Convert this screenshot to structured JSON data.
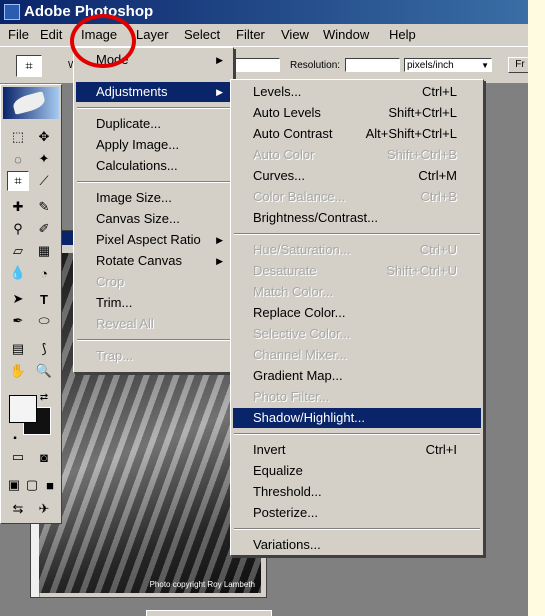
{
  "window": {
    "title": "Adobe Photoshop",
    "app_icon": "photoshop-icon"
  },
  "menubar": {
    "items": [
      "File",
      "Edit",
      "Image",
      "Layer",
      "Select",
      "Filter",
      "View",
      "Window",
      "Help"
    ]
  },
  "options_bar": {
    "width_label": "W",
    "resolution_label": "Resolution:",
    "resolution_value": "",
    "units": "pixels/inch",
    "front_button": "Fr"
  },
  "image_menu": {
    "items": [
      {
        "label": "Mode",
        "submenu": true,
        "disabled": false
      },
      {
        "label": "Adjustments",
        "submenu": true,
        "disabled": false,
        "highlighted": true
      },
      {
        "label": "Duplicate...",
        "disabled": false
      },
      {
        "label": "Apply Image...",
        "disabled": false
      },
      {
        "label": "Calculations...",
        "disabled": false
      },
      {
        "label": "Image Size...",
        "disabled": false
      },
      {
        "label": "Canvas Size...",
        "disabled": false
      },
      {
        "label": "Pixel Aspect Ratio",
        "submenu": true,
        "disabled": false
      },
      {
        "label": "Rotate Canvas",
        "submenu": true,
        "disabled": false
      },
      {
        "label": "Crop",
        "disabled": true
      },
      {
        "label": "Trim...",
        "disabled": false
      },
      {
        "label": "Reveal All",
        "disabled": true
      },
      {
        "label": "Trap...",
        "disabled": true
      }
    ]
  },
  "adjustments_menu": {
    "items": [
      {
        "label": "Levels...",
        "shortcut": "Ctrl+L",
        "disabled": false
      },
      {
        "label": "Auto Levels",
        "shortcut": "Shift+Ctrl+L",
        "disabled": false
      },
      {
        "label": "Auto Contrast",
        "shortcut": "Alt+Shift+Ctrl+L",
        "disabled": false
      },
      {
        "label": "Auto Color",
        "shortcut": "Shift+Ctrl+B",
        "disabled": true
      },
      {
        "label": "Curves...",
        "shortcut": "Ctrl+M",
        "disabled": false
      },
      {
        "label": "Color Balance...",
        "shortcut": "Ctrl+B",
        "disabled": true
      },
      {
        "label": "Brightness/Contrast...",
        "shortcut": "",
        "disabled": false
      },
      {
        "label": "Hue/Saturation...",
        "shortcut": "Ctrl+U",
        "disabled": true
      },
      {
        "label": "Desaturate",
        "shortcut": "Shift+Ctrl+U",
        "disabled": true
      },
      {
        "label": "Match Color...",
        "shortcut": "",
        "disabled": true
      },
      {
        "label": "Replace Color...",
        "shortcut": "",
        "disabled": false
      },
      {
        "label": "Selective Color...",
        "shortcut": "",
        "disabled": true
      },
      {
        "label": "Channel Mixer...",
        "shortcut": "",
        "disabled": true
      },
      {
        "label": "Gradient Map...",
        "shortcut": "",
        "disabled": false
      },
      {
        "label": "Photo Filter...",
        "shortcut": "",
        "disabled": true
      },
      {
        "label": "Shadow/Highlight...",
        "shortcut": "",
        "disabled": false,
        "highlighted": true
      },
      {
        "label": "Invert",
        "shortcut": "Ctrl+I",
        "disabled": false
      },
      {
        "label": "Equalize",
        "shortcut": "",
        "disabled": false
      },
      {
        "label": "Threshold...",
        "shortcut": "",
        "disabled": false
      },
      {
        "label": "Posterize...",
        "shortcut": "",
        "disabled": false
      },
      {
        "label": "Variations...",
        "shortcut": "",
        "disabled": false
      }
    ]
  },
  "image_window": {
    "credit": "Photo copyright Roy Lambeth"
  },
  "colors": {
    "highlight": "#0a246a",
    "menu_bg": "#d4d0c8",
    "annotation": "#e00000"
  }
}
